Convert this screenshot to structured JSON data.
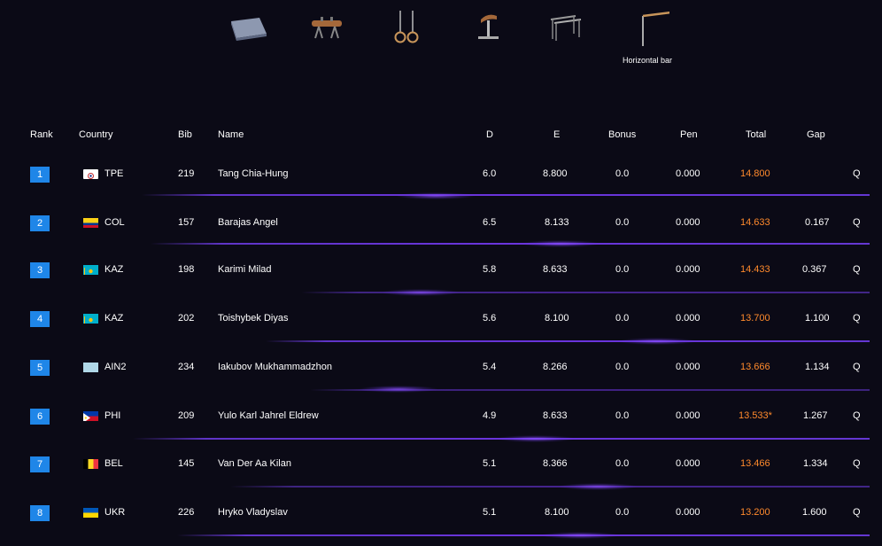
{
  "apparatus": [
    {
      "id": "floor",
      "icon": "floor-mat-icon",
      "label": ""
    },
    {
      "id": "pommel",
      "icon": "pommel-horse-icon",
      "label": ""
    },
    {
      "id": "rings",
      "icon": "rings-icon",
      "label": ""
    },
    {
      "id": "vault",
      "icon": "vault-icon",
      "label": ""
    },
    {
      "id": "pbars",
      "icon": "parallel-bars-icon",
      "label": ""
    },
    {
      "id": "hbar",
      "icon": "horizontal-bar-icon",
      "label": "Horizontal bar"
    }
  ],
  "columns": {
    "rank": "Rank",
    "country": "Country",
    "bib": "Bib",
    "name": "Name",
    "d": "D",
    "e": "E",
    "bonus": "Bonus",
    "pen": "Pen",
    "total": "Total",
    "gap": "Gap"
  },
  "colors": {
    "background": "#0b0a16",
    "rank_badge": "#1f86e8",
    "total_text": "#ff8a2c",
    "divider": "#6a34dc"
  },
  "rows": [
    {
      "rank": "1",
      "country": "TPE",
      "flag": "tpe",
      "bib": "219",
      "name": "Tang Chia-Hung",
      "d": "6.0",
      "e": "8.800",
      "bonus": "0.0",
      "pen": "0.000",
      "total": "14.800",
      "gap": "",
      "q": "Q"
    },
    {
      "rank": "2",
      "country": "COL",
      "flag": "col",
      "bib": "157",
      "name": "Barajas Angel",
      "d": "6.5",
      "e": "8.133",
      "bonus": "0.0",
      "pen": "0.000",
      "total": "14.633",
      "gap": "0.167",
      "q": "Q"
    },
    {
      "rank": "3",
      "country": "KAZ",
      "flag": "kaz",
      "bib": "198",
      "name": "Karimi Milad",
      "d": "5.8",
      "e": "8.633",
      "bonus": "0.0",
      "pen": "0.000",
      "total": "14.433",
      "gap": "0.367",
      "q": "Q"
    },
    {
      "rank": "4",
      "country": "KAZ",
      "flag": "kaz",
      "bib": "202",
      "name": "Toishybek Diyas",
      "d": "5.6",
      "e": "8.100",
      "bonus": "0.0",
      "pen": "0.000",
      "total": "13.700",
      "gap": "1.100",
      "q": "Q"
    },
    {
      "rank": "5",
      "country": "AIN2",
      "flag": "ain",
      "bib": "234",
      "name": "Iakubov Mukhammadzhon",
      "d": "5.4",
      "e": "8.266",
      "bonus": "0.0",
      "pen": "0.000",
      "total": "13.666",
      "gap": "1.134",
      "q": "Q"
    },
    {
      "rank": "6",
      "country": "PHI",
      "flag": "phi",
      "bib": "209",
      "name": "Yulo Karl Jahrel Eldrew",
      "d": "4.9",
      "e": "8.633",
      "bonus": "0.0",
      "pen": "0.000",
      "total": "13.533*",
      "gap": "1.267",
      "q": "Q"
    },
    {
      "rank": "7",
      "country": "BEL",
      "flag": "bel",
      "bib": "145",
      "name": "Van Der Aa Kilan",
      "d": "5.1",
      "e": "8.366",
      "bonus": "0.0",
      "pen": "0.000",
      "total": "13.466",
      "gap": "1.334",
      "q": "Q"
    },
    {
      "rank": "8",
      "country": "UKR",
      "flag": "ukr",
      "bib": "226",
      "name": "Hryko Vladyslav",
      "d": "5.1",
      "e": "8.100",
      "bonus": "0.0",
      "pen": "0.000",
      "total": "13.200",
      "gap": "1.600",
      "q": "Q"
    }
  ]
}
